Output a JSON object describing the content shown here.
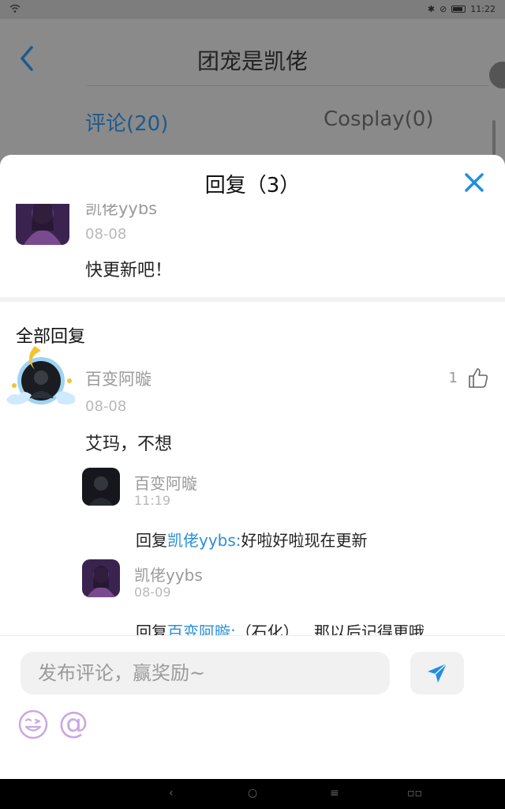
{
  "status_bar": {
    "time": "11:22"
  },
  "background_page": {
    "title": "团宠是凯佬",
    "tabs": [
      {
        "label": "评论(20)"
      },
      {
        "label": "Cosplay(0)"
      }
    ]
  },
  "sheet": {
    "title": "回复（3）",
    "original_comment": {
      "author": "凯佬yybs",
      "date": "08-08",
      "text": "快更新吧！"
    },
    "section_title": "全部回复",
    "reply": {
      "author": "百变阿暶",
      "date": "08-08",
      "text": "艾玛，不想",
      "likes": "1",
      "sub_replies": [
        {
          "author": "百变阿暶",
          "time": "11:19",
          "prefix": "回复",
          "mention": "凯佬yybs:",
          "text": "好啦好啦现在更新"
        },
        {
          "author": "凯佬yybs",
          "time": "08-09",
          "prefix": "回复",
          "mention": "百变阿暶:",
          "text": "（石化）...那以后记得更哦"
        }
      ]
    }
  },
  "composer": {
    "placeholder": "发布评论，赢奖励~",
    "at_symbol": "@"
  },
  "colors": {
    "accent": "#2b8fd6",
    "close": "#1e8fe0"
  },
  "icons": [
    "back-icon",
    "close-icon",
    "thumbs-up-icon",
    "send-icon",
    "emoji-icon",
    "at-icon"
  ]
}
